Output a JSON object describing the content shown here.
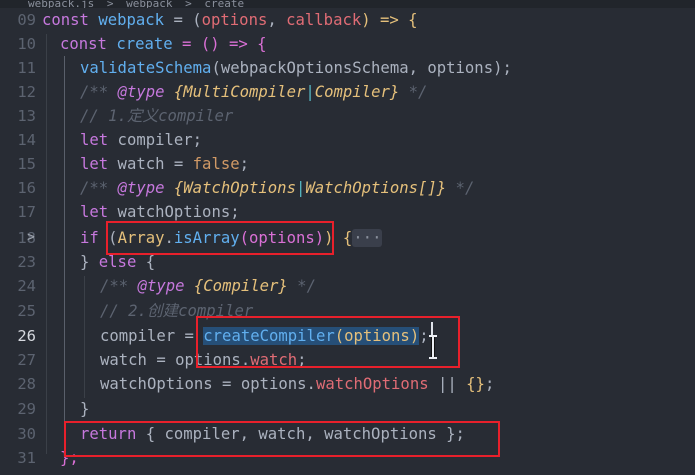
{
  "breadcrumb": {
    "file": "webpack.js",
    "symbol": "webpack",
    "function": "create",
    "separator": ">"
  },
  "editor": {
    "line_numbers": [
      "09",
      "10",
      "11",
      "12",
      "13",
      "14",
      "15",
      "16",
      "17",
      "18",
      "23",
      "24",
      "25",
      "26",
      "27",
      "28",
      "29",
      "30",
      "31"
    ],
    "folded_line": "18",
    "fold_marker": ">",
    "ellipsis": "···",
    "code": {
      "l09": {
        "t1": "const",
        "t2": " webpack",
        "t3": " = (",
        "t4": "options",
        "t5": ", ",
        "t6": "callback",
        "t7": ") => {"
      },
      "l10": {
        "t1": "const",
        "t2": " create",
        "t3": " = () => {"
      },
      "l11": {
        "t1": "validateSchema",
        "t2": "(webpackOptionsSchema, options);"
      },
      "l12": {
        "t1": "/** ",
        "t2": "@type",
        "t3": " {MultiCompiler",
        "t4": "|",
        "t5": "Compiler}",
        "t6": " */"
      },
      "l13": {
        "t1": "// 1.定义compiler"
      },
      "l14": {
        "t1": "let",
        "t2": " compiler;"
      },
      "l15": {
        "t1": "let",
        "t2": " watch = ",
        "t3": "false",
        "t4": ";"
      },
      "l16": {
        "t1": "/** ",
        "t2": "@type",
        "t3": " {WatchOptions",
        "t4": "|",
        "t5": "WatchOptions[]}",
        "t6": " */"
      },
      "l17": {
        "t1": "let",
        "t2": " watchOptions;"
      },
      "l18": {
        "t1": "if",
        "t2": " (",
        "t3": "Array",
        "t4": ".",
        "t5": "isArray",
        "t6": "(options)",
        "t7": ") {"
      },
      "l23": {
        "t1": "} ",
        "t2": "else",
        "t3": " {"
      },
      "l24": {
        "t1": "/** ",
        "t2": "@type",
        "t3": " {Compiler}",
        "t4": " */"
      },
      "l25": {
        "t1": "// 2.创建compiler"
      },
      "l26": {
        "t1": "compiler = ",
        "t2": "createCompiler",
        "t3": "(options)",
        "t4": ";"
      },
      "l27": {
        "t1": "watch = options.",
        "t2": "watch",
        "t3": ";"
      },
      "l28": {
        "t1": "watchOptions = options.",
        "t2": "watchOptions",
        "t3": " || ",
        "t4": "{}",
        "t5": ";"
      },
      "l29": {
        "t1": "}"
      },
      "l30": {
        "t1": "return",
        "t2": " { compiler, watch, watchOptions };"
      },
      "l31": {
        "t1": "};"
      }
    }
  },
  "colors": {
    "background": "#282c34",
    "keyword": "#c678dd",
    "function": "#61afef",
    "variable": "#e06c75",
    "type": "#e5c07b",
    "boolean": "#d19a66",
    "comment": "#5c6370",
    "annotation_box": "#e8202b"
  }
}
